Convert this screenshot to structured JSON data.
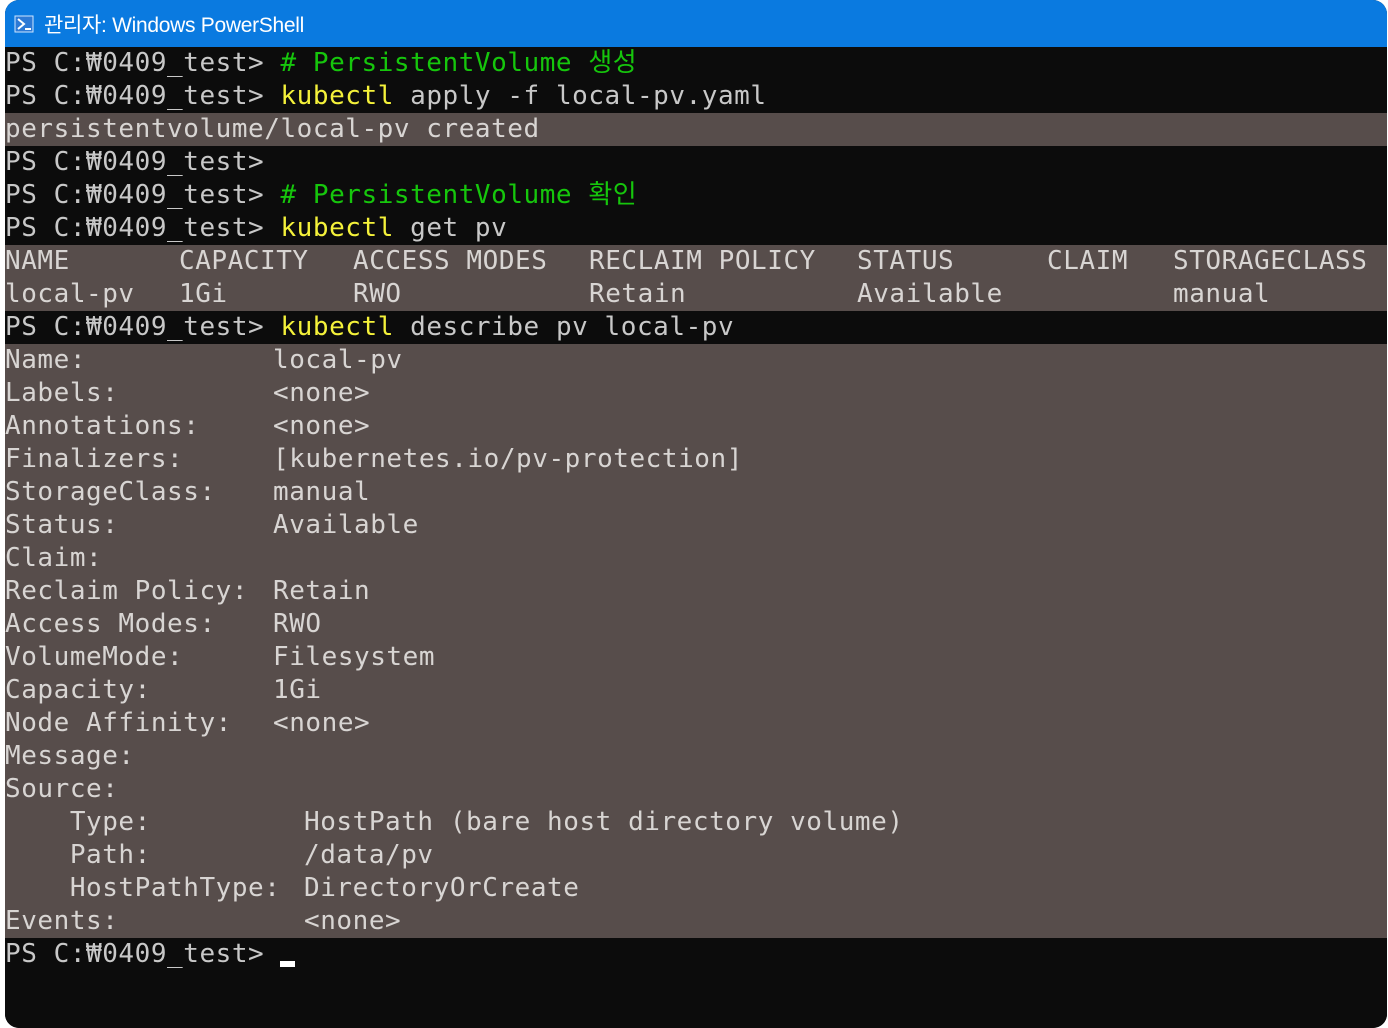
{
  "window": {
    "title": "관리자: Windows PowerShell",
    "icon": "powershell-icon",
    "accent": "#0a7ae0"
  },
  "prompt": "PS C:₩0409_test> ",
  "commands": {
    "c1_comment": "# PersistentVolume 생성",
    "c2_cmd": "kubectl",
    "c2_args": " apply -f local-pv.yaml",
    "c2_output": "persistentvolume/local-pv created",
    "c4_comment": "# PersistentVolume 확인",
    "c5_cmd": "kubectl",
    "c5_args": " get pv",
    "c6_cmd": "kubectl",
    "c6_args": " describe pv local-pv"
  },
  "pv_table": {
    "headers": [
      "NAME",
      "CAPACITY",
      "ACCESS MODES",
      "RECLAIM POLICY",
      "STATUS",
      "CLAIM",
      "STORAGECLASS"
    ],
    "rows": [
      [
        "local-pv",
        "1Gi",
        "RWO",
        "Retain",
        "Available",
        "",
        "manual"
      ]
    ]
  },
  "describe": [
    {
      "key": "Name:",
      "value": "local-pv"
    },
    {
      "key": "Labels:",
      "value": "<none>"
    },
    {
      "key": "Annotations:",
      "value": "<none>"
    },
    {
      "key": "Finalizers:",
      "value": "[kubernetes.io/pv-protection]"
    },
    {
      "key": "StorageClass:",
      "value": "manual"
    },
    {
      "key": "Status:",
      "value": "Available"
    },
    {
      "key": "Claim:",
      "value": ""
    },
    {
      "key": "Reclaim Policy:",
      "value": "Retain"
    },
    {
      "key": "Access Modes:",
      "value": "RWO"
    },
    {
      "key": "VolumeMode:",
      "value": "Filesystem"
    },
    {
      "key": "Capacity:",
      "value": "1Gi"
    },
    {
      "key": "Node Affinity:",
      "value": "<none>"
    },
    {
      "key": "Message:",
      "value": ""
    },
    {
      "key": "Source:",
      "value": ""
    }
  ],
  "source": [
    {
      "key": "    Type:",
      "value": "HostPath (bare host directory volume)"
    },
    {
      "key": "    Path:",
      "value": "/data/pv"
    },
    {
      "key": "    HostPathType:",
      "value": "DirectoryOrCreate"
    }
  ],
  "events": {
    "key": "Events:",
    "value": "<none>"
  },
  "colors": {
    "console_bg": "#0c0c0c",
    "output_bg": "#574d4b",
    "command": "#f4f13a",
    "comment": "#16c60c",
    "text": "#c8c8c8"
  }
}
